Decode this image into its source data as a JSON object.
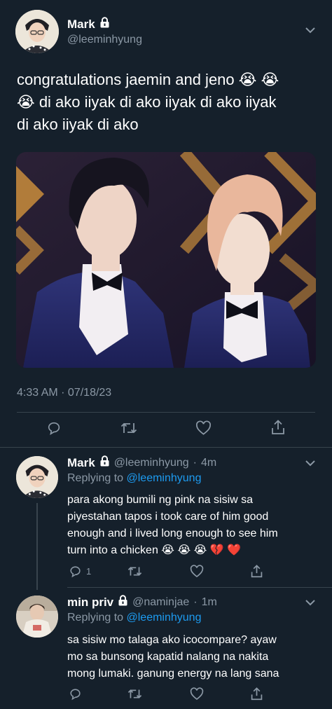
{
  "main_tweet": {
    "author_name": "Mark",
    "author_handle": "@leeminhyung",
    "text_line1": "congratulations jaemin and jeno 😭 😭",
    "text_line2": "😭 di ako iiyak di ako iiyak di ako iiyak",
    "text_line3": "di ako iiyak di ako",
    "timestamp": "4:33 AM · 07/18/23"
  },
  "replies": [
    {
      "author_name": "Mark",
      "author_handle": "@leeminhyung",
      "age": "4m",
      "replying_prefix": "Replying to",
      "replying_to": "@leeminhyung",
      "text_line1": "para akong bumili ng pink na sisiw sa",
      "text_line2": "piyestahan tapos i took care of him good",
      "text_line3": "enough and i lived long enough to see him",
      "text_line4": "turn into a chicken 😭 😭 😭 💔 ❤️",
      "reply_count": "1"
    },
    {
      "author_name": "min priv",
      "author_handle": "@naminjae",
      "age": "1m",
      "replying_prefix": "Replying to",
      "replying_to": "@leeminhyung",
      "text_line1": "sa sisiw mo talaga ako icocompare? ayaw",
      "text_line2": "mo sa bunsong kapatid nalang na nakita",
      "text_line3": "mong lumaki. ganung energy na lang sana",
      "reply_count": ""
    }
  ],
  "icons": {
    "lock": "lock-icon",
    "chevron": "chevron-down-icon",
    "reply": "reply-icon",
    "retweet": "retweet-icon",
    "like": "heart-icon",
    "share": "share-icon"
  },
  "colors": {
    "background": "#15202b",
    "text": "#ffffff",
    "muted": "#8b98a5",
    "link": "#1d9bf0",
    "divider": "#38444d"
  }
}
